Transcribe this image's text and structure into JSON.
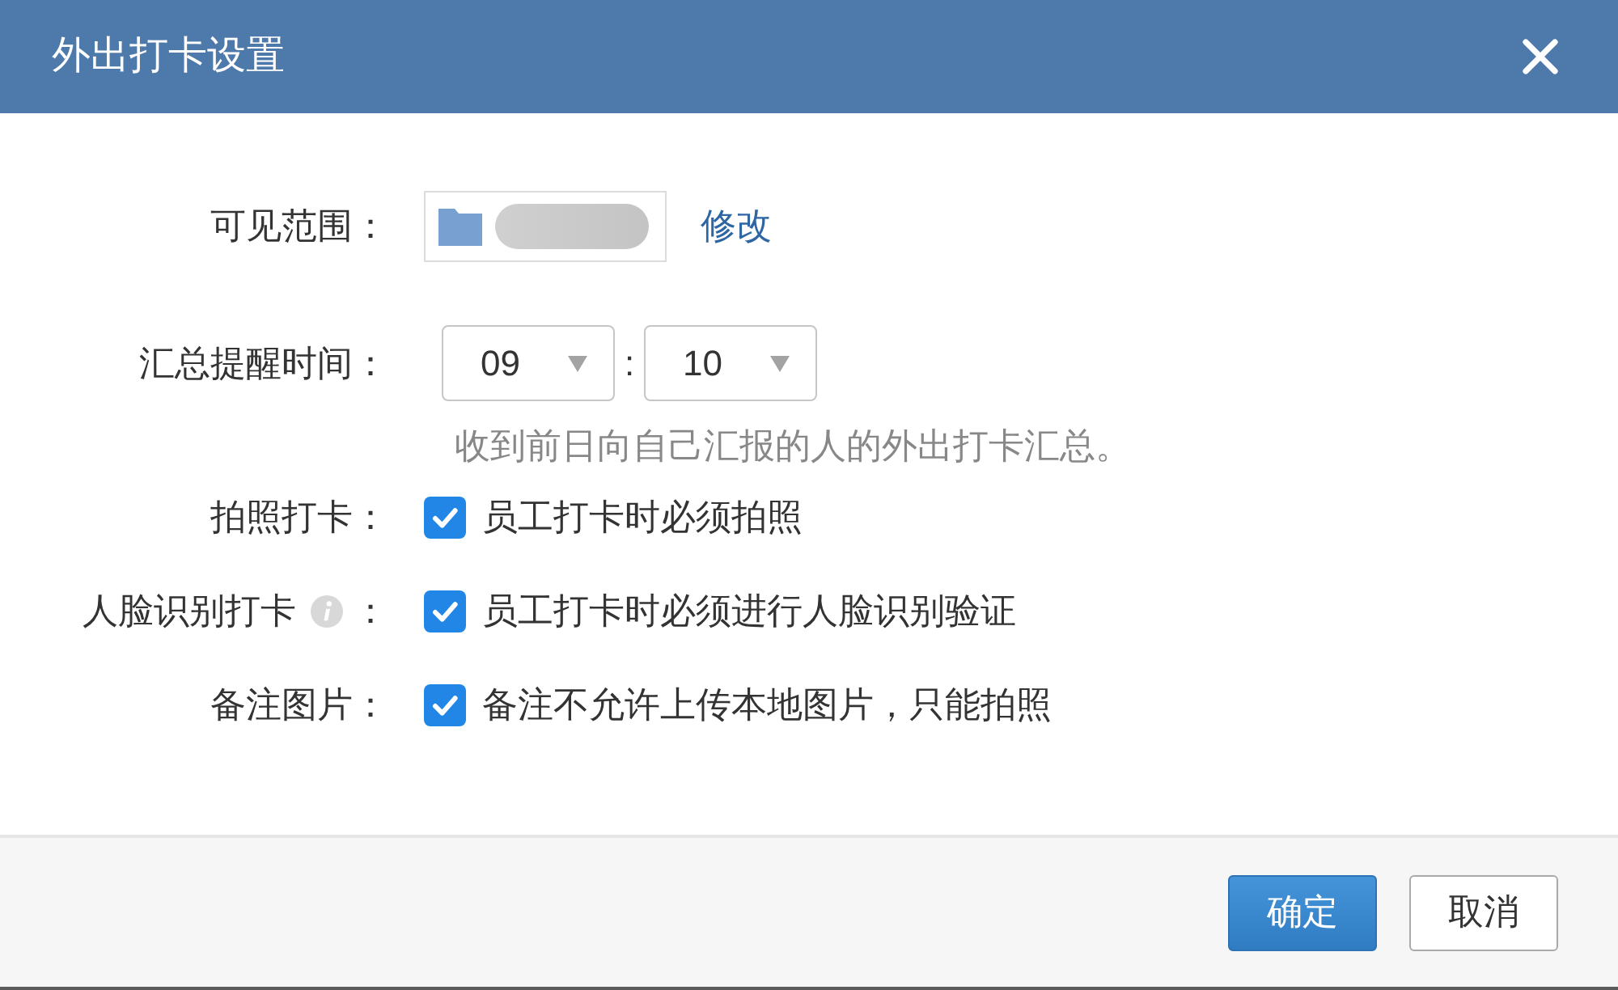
{
  "dialog": {
    "title": "外出打卡设置"
  },
  "fields": [
    {
      "kind": "scope",
      "label": "可见范围：",
      "action": "修改"
    },
    {
      "kind": "time",
      "label": "汇总提醒时间：",
      "hour": "09",
      "separator": ":",
      "minute": "10",
      "hint": "收到前日向自己汇报的人的外出打卡汇总。"
    },
    {
      "kind": "checkbox",
      "label": "拍照打卡：",
      "info": false,
      "option": "员工打卡时必须拍照",
      "checked": true
    },
    {
      "kind": "checkbox",
      "label": "人脸识别打卡",
      "info": true,
      "colon": "：",
      "option": "员工打卡时必须进行人脸识别验证",
      "checked": true
    },
    {
      "kind": "checkbox",
      "label": "备注图片：",
      "info": false,
      "option": "备注不允许上传本地图片，只能拍照",
      "checked": true
    }
  ],
  "buttons": [
    {
      "kind": "primary",
      "label": "确定"
    },
    {
      "kind": "secondary",
      "label": "取消"
    }
  ]
}
